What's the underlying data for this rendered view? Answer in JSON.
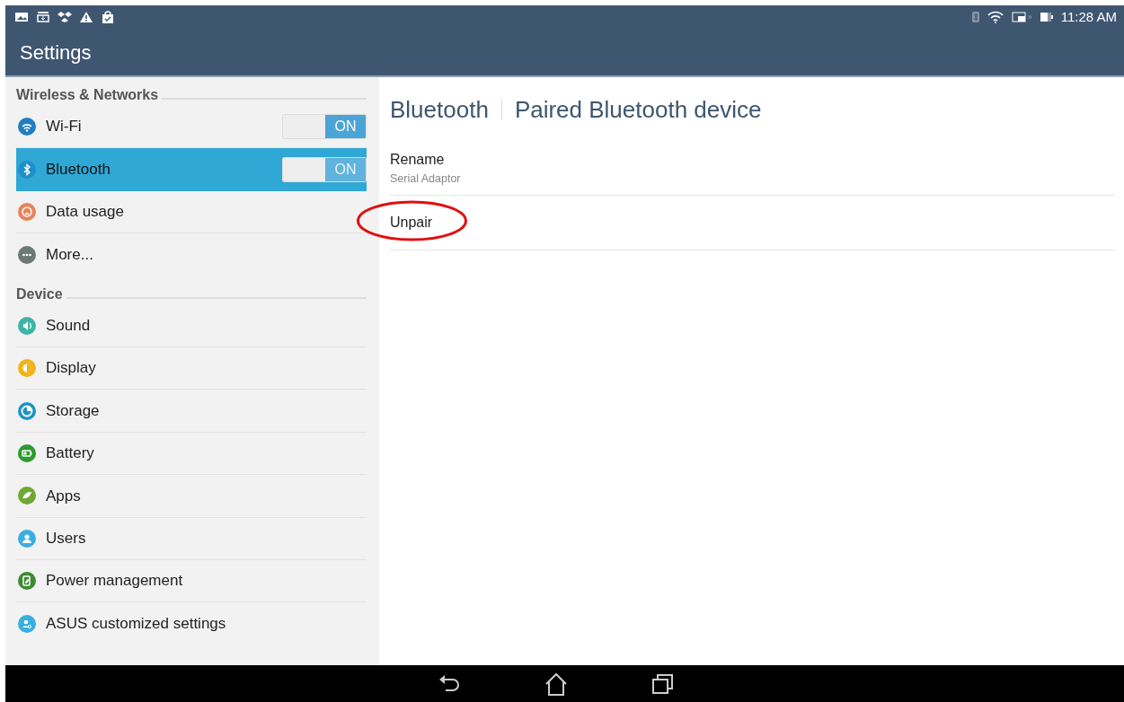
{
  "status_bar": {
    "time": "11:28 AM"
  },
  "app_bar": {
    "title": "Settings"
  },
  "sidebar": {
    "sections": [
      {
        "title": "Wireless & Networks",
        "items": [
          {
            "label": "Wi-Fi",
            "color": "#1f7fc0",
            "selected": false,
            "toggle": {
              "label": "ON",
              "on": true
            }
          },
          {
            "label": "Bluetooth",
            "color": "#1e8fc8",
            "selected": true,
            "toggle": {
              "label": "ON",
              "on": true
            }
          },
          {
            "label": "Data usage",
            "color": "#e8825a",
            "selected": false
          },
          {
            "label": "More...",
            "color": "#6d7a73",
            "selected": false
          }
        ]
      },
      {
        "title": "Device",
        "items": [
          {
            "label": "Sound",
            "color": "#3fb3a8",
            "selected": false
          },
          {
            "label": "Display",
            "color": "#f0b41a",
            "selected": false
          },
          {
            "label": "Storage",
            "color": "#1f93c6",
            "selected": false
          },
          {
            "label": "Battery",
            "color": "#2e9a2e",
            "selected": false
          },
          {
            "label": "Apps",
            "color": "#6fa832",
            "selected": false
          },
          {
            "label": "Users",
            "color": "#3aaee0",
            "selected": false
          },
          {
            "label": "Power management",
            "color": "#3d8a32",
            "selected": false
          },
          {
            "label": "ASUS customized settings",
            "color": "#3aaee0",
            "selected": false
          }
        ]
      }
    ]
  },
  "content": {
    "breadcrumb": [
      "Bluetooth",
      "Paired Bluetooth device"
    ],
    "items": [
      {
        "title": "Rename",
        "subtitle": "Serial Adaptor",
        "highlighted": false
      },
      {
        "title": "Unpair",
        "highlighted": true
      }
    ]
  }
}
